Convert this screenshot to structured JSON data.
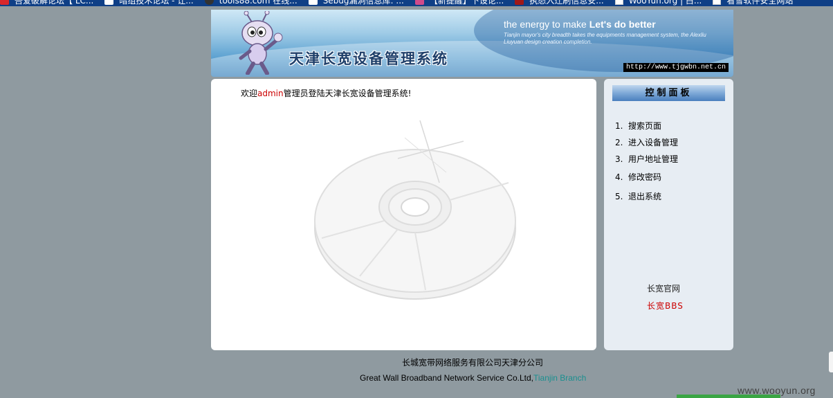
{
  "bookmarks": [
    {
      "label": "吾爱破解论坛【 LC...",
      "icon": "red-badge-icon"
    },
    {
      "label": "暗组技术论坛 - 让...",
      "icon": "x-logo-icon"
    },
    {
      "label": "tools88.com 在线...",
      "icon": "circle-logo-icon"
    },
    {
      "label": "Sebug漏洞信息库: ...",
      "icon": "s-logo-icon"
    },
    {
      "label": "【新提醒】下设论...",
      "icon": "pink-logo-icon"
    },
    {
      "label": "执悉入迁刷信息安...",
      "icon": "red-x-logo-icon"
    },
    {
      "label": "WooYun.org | 白...",
      "icon": "checkbox-icon"
    },
    {
      "label": "看雪软件安全网站",
      "icon": "checkbox-icon"
    }
  ],
  "header": {
    "title": "天津长宽设备管理系统",
    "slogan_prefix": "the energy to make ",
    "slogan_bold": "Let's do better",
    "subtitle": "Tianjin mayor's city breadth takes the equipments management system, the Alexliu Liuyuan design creation completion.",
    "url": "http://www.tjgwbn.net.cn"
  },
  "main": {
    "welcome_prefix": "欢迎",
    "welcome_user": "admin",
    "welcome_suffix": "管理员登陆天津长宽设备管理系统!"
  },
  "sidebar": {
    "heading": "控制面板",
    "items": [
      {
        "num": "1.",
        "label": "搜索页面"
      },
      {
        "num": "2.",
        "label": "进入设备管理"
      },
      {
        "num": "3.",
        "label": "用户地址管理"
      },
      {
        "num": "4.",
        "label": "修改密码"
      },
      {
        "num": "5.",
        "label": "退出系统"
      }
    ],
    "link_official": "长宽官网",
    "link_bbs": "长宽BBS"
  },
  "footer": {
    "company_cn": "长城宽带网络服务有限公司天津分公司",
    "company_en": "Great Wall Broadband Network Service Co.Ltd,",
    "branch": "Tianjin Branch"
  },
  "watermark": "www.wooyun.org",
  "colors": {
    "page_bg": "#8f9aa0",
    "accent_red": "#cc0000",
    "branch_teal": "#1a8f8f",
    "panel_head": "#7ea9d7"
  }
}
